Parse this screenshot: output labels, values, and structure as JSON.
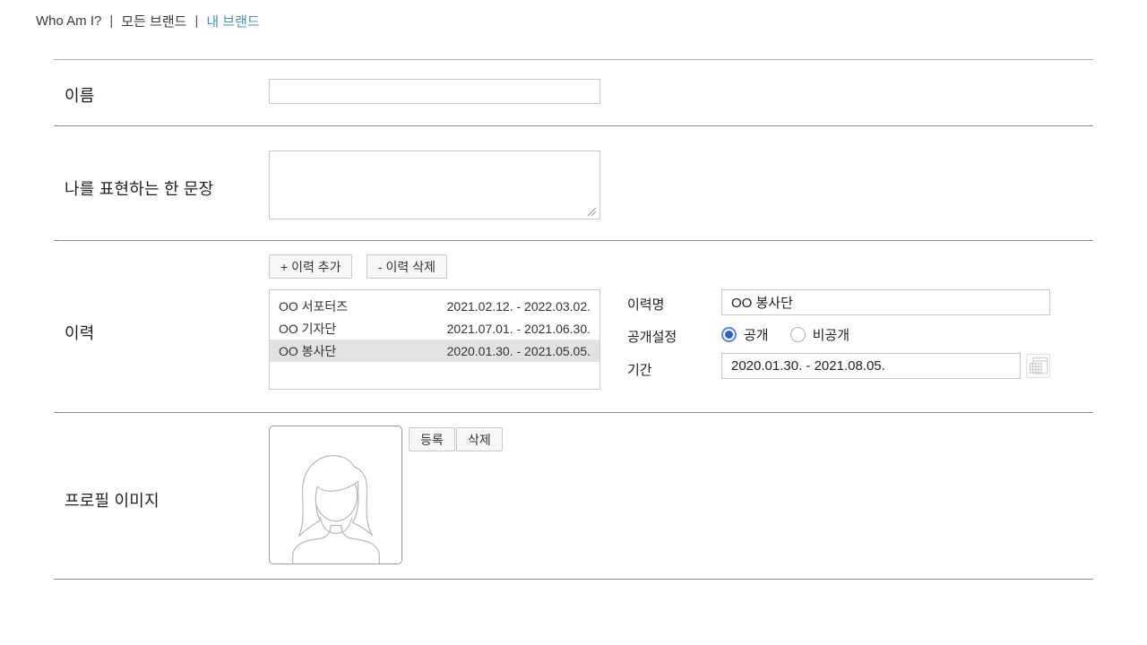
{
  "colors": {
    "accent": "#4a90be",
    "radio_dot": "#2f62c4",
    "radio_ring": "#5b87d0",
    "list_selected_bg": "#e2e2e2"
  },
  "nav": {
    "separator": "|",
    "items": [
      {
        "label": "Who Am I?"
      },
      {
        "label": "모든 브랜드"
      },
      {
        "label": "내 브랜드",
        "active": true
      }
    ]
  },
  "form": {
    "name": {
      "label": "이름",
      "value": ""
    },
    "sentence": {
      "label": "나를 표현하는 한 문장",
      "value": ""
    },
    "history": {
      "label": "이력",
      "add_button": "+ 이력 추가",
      "delete_button": "- 이력 삭제",
      "items": [
        {
          "name": "OO 서포터즈",
          "period": "2021.02.12. - 2022.03.02.",
          "selected": false
        },
        {
          "name": "OO 기자단",
          "period": "2021.07.01. - 2021.06.30.",
          "selected": false
        },
        {
          "name": "OO 봉사단",
          "period": "2020.01.30. - 2021.05.05.",
          "selected": true
        }
      ],
      "detail": {
        "name_label": "이력명",
        "name_value": "OO 봉사단",
        "visibility_label": "공개설정",
        "visibility_options": [
          {
            "label": "공개",
            "selected": true
          },
          {
            "label": "비공개",
            "selected": false
          }
        ],
        "period_label": "기간",
        "period_value": "2020.01.30. - 2021.08.05.",
        "calendar_icon": "calendar-icon"
      }
    },
    "profile_image": {
      "label": "프로필 이미지",
      "register_button": "등록",
      "delete_button": "삭제",
      "avatar_icon": "person-icon"
    }
  }
}
